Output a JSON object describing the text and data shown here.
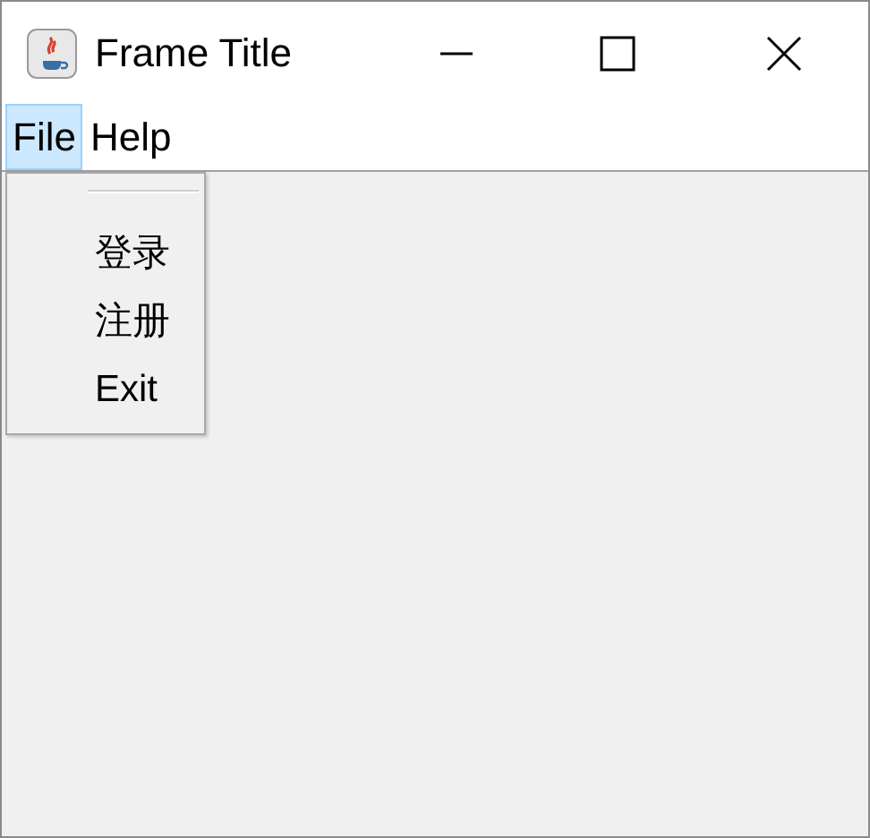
{
  "window": {
    "title": "Frame Title"
  },
  "menu_bar": [
    {
      "label": "File",
      "selected": true
    },
    {
      "label": "Help",
      "selected": false
    }
  ],
  "open_menu": {
    "items": [
      {
        "kind": "separator"
      },
      {
        "kind": "item",
        "label": "登录"
      },
      {
        "kind": "item",
        "label": "注册"
      },
      {
        "kind": "item",
        "label": "Exit"
      }
    ]
  }
}
